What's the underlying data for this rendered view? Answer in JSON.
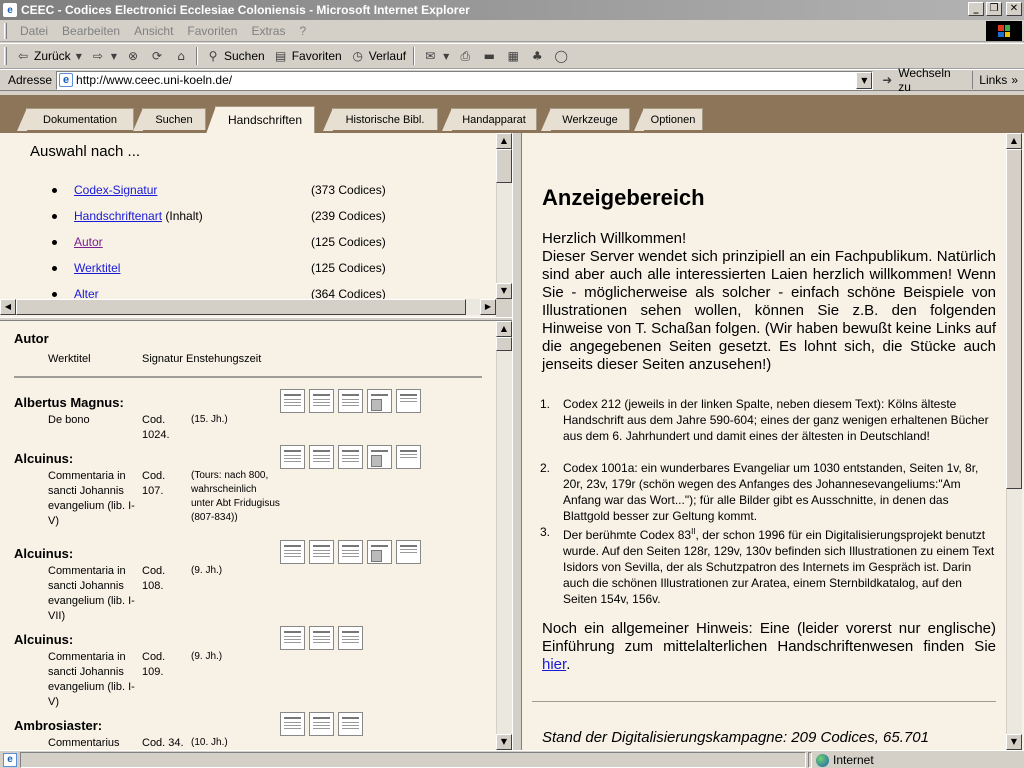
{
  "window": {
    "title": "CEEC - Codices Electronici Ecclesiae Coloniensis - Microsoft Internet Explorer",
    "controls": {
      "minimize": "_",
      "maximize": "❐",
      "close": "✕"
    }
  },
  "menu": [
    "Datei",
    "Bearbeiten",
    "Ansicht",
    "Favoriten",
    "Extras",
    "?"
  ],
  "toolbar": {
    "back": "Zurück",
    "search": "Suchen",
    "favorites": "Favoriten",
    "history": "Verlauf"
  },
  "address": {
    "label": "Adresse",
    "url": "http://www.ceec.uni-koeln.de/",
    "go": "Wechseln zu",
    "links": "Links",
    "links_arrow": "»"
  },
  "tabs": [
    "Dokumentation",
    "Suchen",
    "Handschriften",
    "Historische Bibl.",
    "Handapparat",
    "Werkzeuge",
    "Optionen"
  ],
  "active_tab": "Handschriften",
  "colors": {
    "tabbar": "#8c7558",
    "page_bg": "#f7f1e6",
    "link": "#1a1ad6",
    "visited_link": "#7a1f8f"
  },
  "selection": {
    "heading": "Auswahl nach ...",
    "items": [
      {
        "link": "Codex-Signatur",
        "suffix": "",
        "count": "(373 Codices)"
      },
      {
        "link": "Handschriftenart",
        "suffix": " (Inhalt)",
        "count": "(239 Codices)"
      },
      {
        "link": "Autor",
        "suffix": "",
        "count": "(125 Codices)"
      },
      {
        "link": "Werktitel",
        "suffix": "",
        "count": "(125 Codices)"
      },
      {
        "link": "Alter",
        "suffix": "",
        "count": "(364 Codices)"
      }
    ]
  },
  "listing": {
    "heading": "Autor",
    "sub_werktitel": "Werktitel",
    "sub_signatur": "Signatur Enstehungszeit",
    "entries": [
      {
        "author": "Albertus Magnus:",
        "title": "De bono",
        "cod": "Cod. 1024.",
        "date": "(15. Jh.)",
        "thumbs": 5
      },
      {
        "author": "Alcuinus:",
        "title": "Commentaria in sancti Johannis evangelium (lib. I-V)",
        "cod": "Cod. 107.",
        "date": "(Tours: nach 800, wahrscheinlich unter Abt Fridugisus (807-834))",
        "thumbs": 5
      },
      {
        "author": "Alcuinus:",
        "title": "Commentaria in sancti Johannis evangelium (lib. I-VII)",
        "cod": "Cod. 108.",
        "date": "(9. Jh.)",
        "thumbs": 5
      },
      {
        "author": "Alcuinus:",
        "title": "Commentaria in sancti Johannis evangelium (lib. I-V)",
        "cod": "Cod. 109.",
        "date": "(9. Jh.)",
        "thumbs": 3
      },
      {
        "author": "Ambrosiaster:",
        "title": "Commentarius",
        "cod": "Cod. 34.",
        "date": "(10. Jh.)",
        "thumbs": 3
      }
    ]
  },
  "display": {
    "heading": "Anzeigebereich",
    "welcome": "Herzlich Willkommen!",
    "intro": "Dieser Server wendet sich prinzipiell an ein Fachpublikum. Natürlich sind aber auch alle interessierten Laien herzlich willkommen! Wenn Sie - möglicherweise als solcher - einfach schöne Beispiele von Illustrationen sehen wollen, können Sie z.B. den folgenden Hinweise von T. Schaßan folgen. (Wir haben bewußt keine Links auf die angegebenen Seiten gesetzt. Es lohnt sich, die Stücke auch jenseits dieser Seiten anzusehen!)",
    "examples": [
      {
        "num": "1.",
        "text": "Codex 212 (jeweils in der linken Spalte, neben diesem Text): Kölns älteste Handschrift aus dem Jahre 590-604; eines der ganz wenigen erhaltenen Bücher aus dem 6. Jahrhundert und damit eines der ältesten in Deutschland!"
      },
      {
        "num": "2.",
        "text": "Codex 1001a: ein wunderbares Evangeliar um 1030 entstanden, Seiten 1v, 8r, 20r, 23v, 179r (schön wegen des Anfanges des Johannesevangeliums:\"Am Anfang war das Wort...\"); für alle Bilder gibt es Ausschnitte, in denen das Blattgold besser zur Geltung kommt."
      },
      {
        "num": "3.",
        "pre": "Der berühmte Codex 83",
        "sup": "II",
        "post": ", der schon 1996 für ein Digitalisierungsprojekt benutzt wurde. Auf den Seiten 128r, 129v, 130v befinden sich Illustrationen zu einem Text Isidors von Sevilla, der als Schutzpatron des Internets im Gespräch ist. Darin auch die schönen Illustrationen zur Aratea, einem Sternbildkatalog, auf den Seiten 154v, 156v."
      }
    ],
    "note_pre": "Noch ein allgemeiner Hinweis: Eine (leider vorerst nur englische) Einführung zum mittelalterlichen Handschriftenwesen finden Sie ",
    "note_link": "hier",
    "note_post": ".",
    "status": "Stand der Digitalisierungskampagne: 209 Codices, 65.701"
  },
  "statusbar": {
    "zone": "Internet"
  }
}
